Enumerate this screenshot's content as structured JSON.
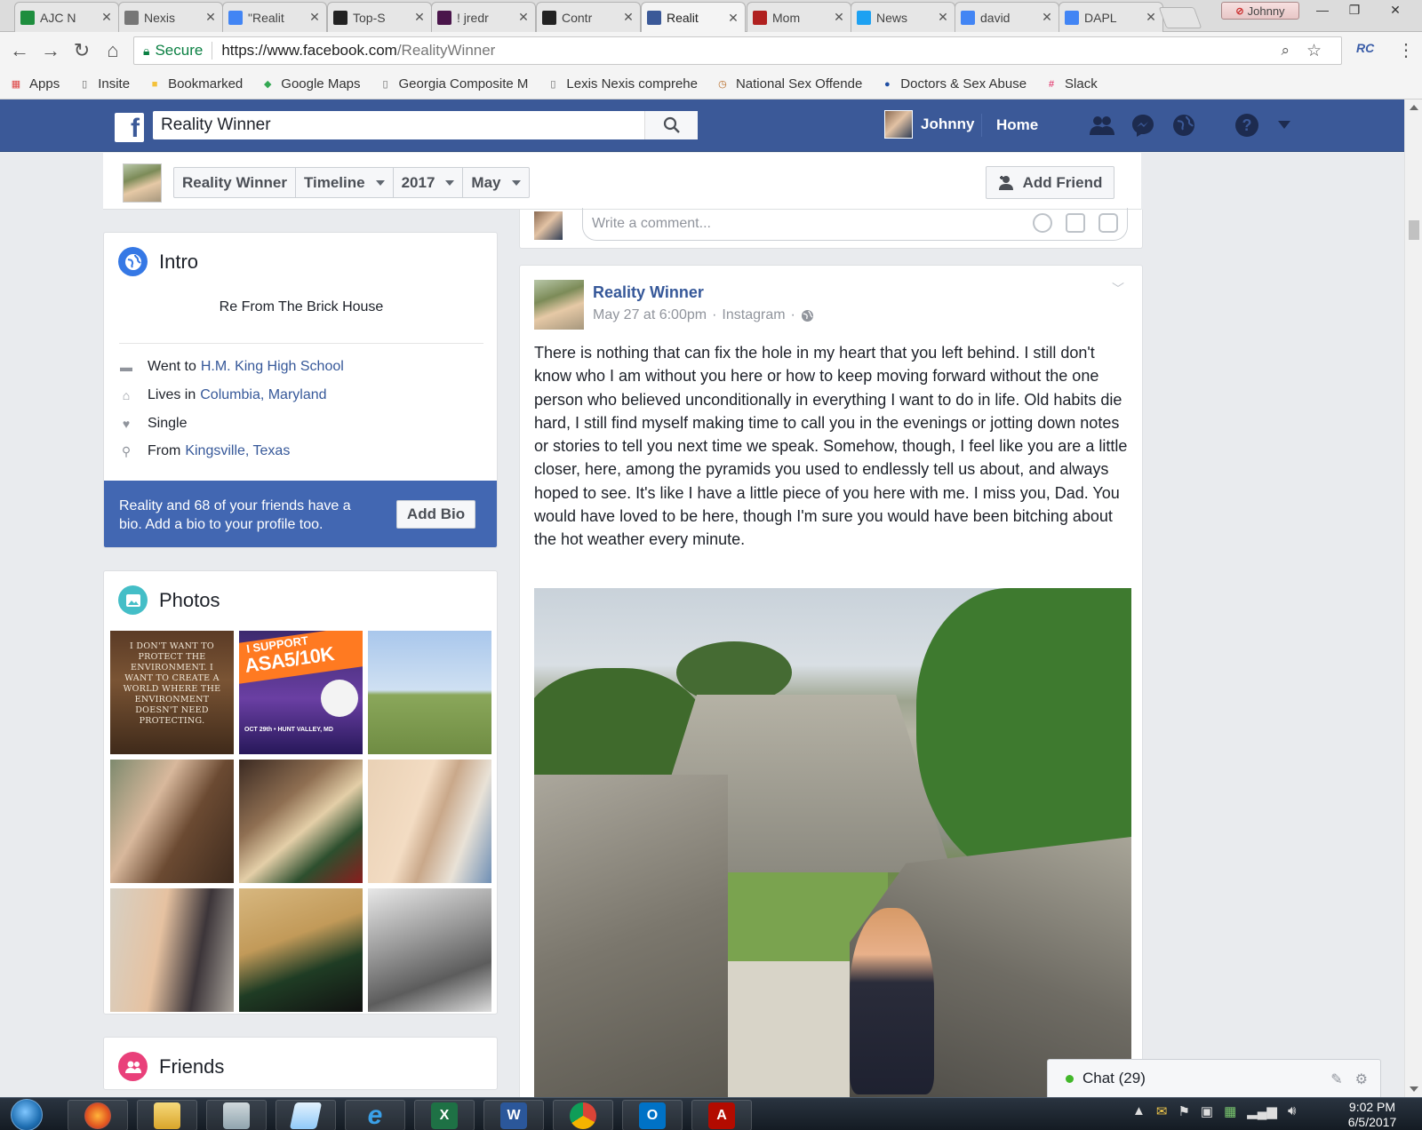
{
  "browser": {
    "tabs": [
      {
        "label": "AJC N",
        "icon": "spreadsheet-icon",
        "color": "#1e8e3e"
      },
      {
        "label": "Nexis",
        "icon": "page-icon",
        "color": "#777777"
      },
      {
        "label": "\"Realit",
        "icon": "google-icon",
        "color": "#4285f4"
      },
      {
        "label": "Top-S",
        "icon": "dark-page-icon",
        "color": "#222222"
      },
      {
        "label": "! jredr",
        "icon": "slack-hash-icon",
        "color": "#4a154b"
      },
      {
        "label": "Contr",
        "icon": "wp-icon",
        "color": "#222222"
      },
      {
        "label": "Realit",
        "icon": "facebook-icon",
        "color": "#3b5998",
        "active": true
      },
      {
        "label": "Mom",
        "icon": "db-icon",
        "color": "#b0201f"
      },
      {
        "label": "News",
        "icon": "twitter-icon",
        "color": "#1da1f2"
      },
      {
        "label": "david",
        "icon": "google-icon",
        "color": "#4285f4"
      },
      {
        "label": "DAPL",
        "icon": "google-icon",
        "color": "#4285f4"
      }
    ],
    "profile_name": "Johnny",
    "url_secure_label": "Secure",
    "url_host": "https://www.facebook.com",
    "url_path": "/RealityWinner",
    "extension_label": "RC",
    "bookmarks": [
      {
        "label": "Apps",
        "icon": "apps-grid-icon"
      },
      {
        "label": "Insite",
        "icon": "page-icon"
      },
      {
        "label": "Bookmarked",
        "icon": "folder-icon"
      },
      {
        "label": "Google Maps",
        "icon": "maps-icon"
      },
      {
        "label": "Georgia Composite M",
        "icon": "page-icon"
      },
      {
        "label": "Lexis Nexis comprehe",
        "icon": "page-icon"
      },
      {
        "label": "National Sex Offende",
        "icon": "clock-badge-icon"
      },
      {
        "label": "Doctors & Sex Abuse",
        "icon": "ajc-icon"
      },
      {
        "label": "Slack",
        "icon": "slack-icon"
      }
    ]
  },
  "facebook": {
    "search_value": "Reality Winner",
    "user_name": "Johnny",
    "home_label": "Home",
    "colors": {
      "brand": "#3b5998",
      "link": "#365899",
      "prompt": "#4267b2"
    }
  },
  "profile_header": {
    "crumbs": [
      "Reality Winner",
      "Timeline",
      "2017",
      "May"
    ],
    "add_friend_label": "Add Friend"
  },
  "intro": {
    "title": "Intro",
    "bio": "Re From The Brick House",
    "rows": [
      {
        "prefix": "Went to",
        "link": "H.M. King High School",
        "icon": "school-icon"
      },
      {
        "prefix": "Lives in",
        "link": "Columbia, Maryland",
        "icon": "home-icon"
      },
      {
        "prefix": "Single",
        "link": "",
        "icon": "heart-icon"
      },
      {
        "prefix": "From",
        "link": "Kingsville, Texas",
        "icon": "location-pin-icon"
      }
    ],
    "bio_prompt": "Reality and 68 of your friends have a bio. Add a bio to your profile too.",
    "add_bio_label": "Add Bio"
  },
  "photos": {
    "title": "Photos",
    "quote_text": "I don't want to protect the environment. I want to create a world where the environment doesn't need protecting.",
    "support_line1": "I SUPPORT",
    "support_line2": "ASA5/10K",
    "support_footer": "OCT 29th • HUNT VALLEY, MD"
  },
  "friends": {
    "title": "Friends"
  },
  "comment": {
    "placeholder": "Write a comment..."
  },
  "post": {
    "author": "Reality Winner",
    "date": "May 27 at 6:00pm",
    "source": "Instagram",
    "text": "There is nothing that can fix the hole in my heart that you left behind. I still don't know who I am without you here or how to keep moving forward without the one person who believed unconditionally in everything I want to do in life. Old habits die hard, I still find myself making time to call you in the evenings or jotting down notes or stories to tell you next time we speak. Somehow, though, I feel like you are a little closer, here, among the pyramids you used to endlessly tell us about, and always hoped to see. It's like I have a little piece of you here with me. I miss you, Dad. You would have loved to be here, though I'm sure you would have been bitching about the hot weather every minute."
  },
  "chat": {
    "label": "Chat (29)"
  },
  "taskbar": {
    "time": "9:02 PM",
    "date": "6/5/2017"
  }
}
